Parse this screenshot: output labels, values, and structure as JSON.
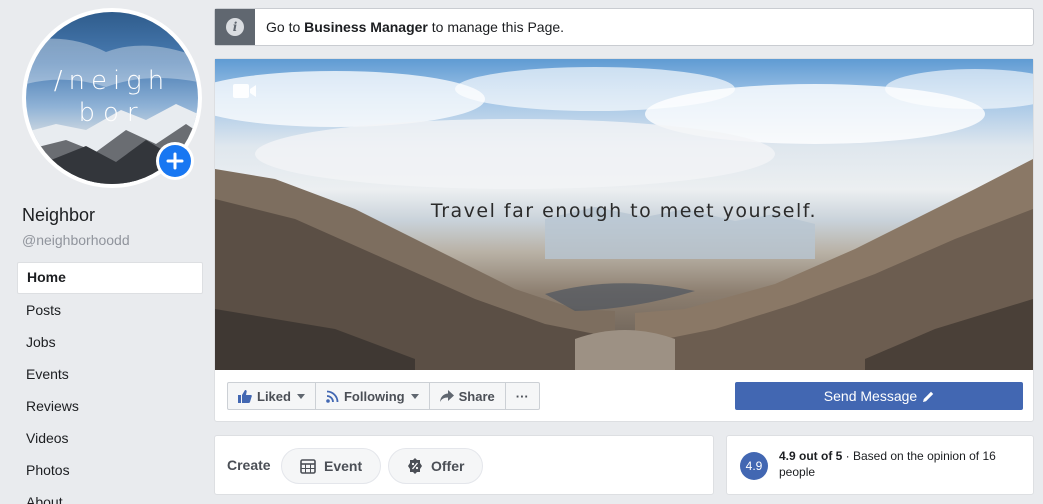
{
  "profile": {
    "avatar_text_line1": "/neigh",
    "avatar_text_line2": "bor",
    "name": "Neighbor",
    "handle": "@neighborhoodd"
  },
  "nav": {
    "items": [
      {
        "label": "Home",
        "active": true
      },
      {
        "label": "Posts"
      },
      {
        "label": "Jobs"
      },
      {
        "label": "Events"
      },
      {
        "label": "Reviews"
      },
      {
        "label": "Videos"
      },
      {
        "label": "Photos"
      },
      {
        "label": "About"
      }
    ]
  },
  "banner": {
    "prefix": "Go to ",
    "link": "Business Manager",
    "suffix": " to manage this Page."
  },
  "cover": {
    "quote": "Travel far enough to meet yourself."
  },
  "actions": {
    "liked": "Liked",
    "following": "Following",
    "share": "Share",
    "more": "···",
    "send_message": "Send Message"
  },
  "create": {
    "label": "Create",
    "event": "Event",
    "offer": "Offer"
  },
  "rating": {
    "badge": "4.9",
    "score": "4.9 out of 5",
    "detail": " · Based on the opinion of 16 people"
  },
  "colors": {
    "accent": "#4267b2",
    "background": "#e9ebee",
    "plus_button": "#1877f2"
  }
}
